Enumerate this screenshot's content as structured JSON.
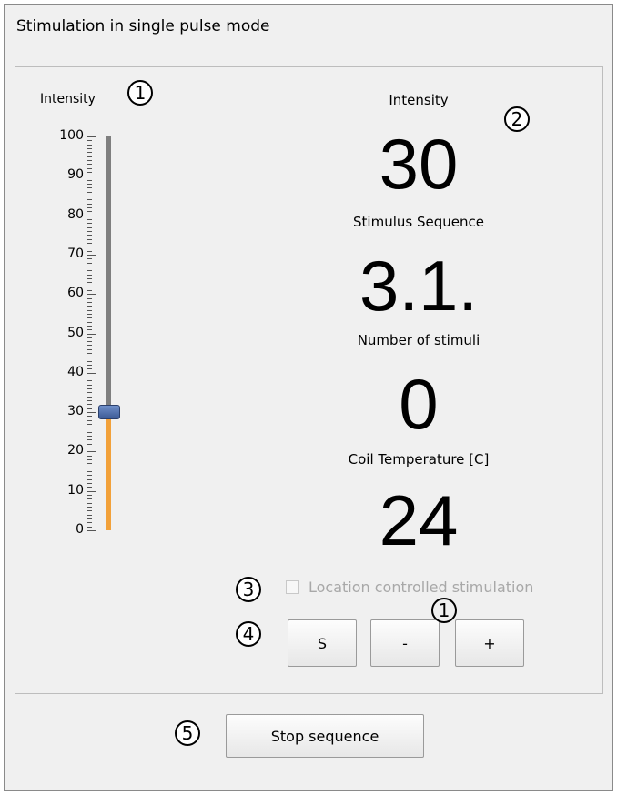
{
  "window": {
    "title": "Stimulation in single pulse mode"
  },
  "slider": {
    "label": "Intensity",
    "scale_labels": [
      "100",
      "90",
      "80",
      "70",
      "60",
      "50",
      "40",
      "30",
      "20",
      "10",
      "0"
    ],
    "value": 30,
    "min": 0,
    "max": 100,
    "filled_color": "#f2a13a",
    "track_color": "#7f7f7f"
  },
  "readouts": [
    {
      "label": "Intensity",
      "value": "30"
    },
    {
      "label": "Stimulus Sequence",
      "value": "3.1."
    },
    {
      "label": "Number of stimuli",
      "value": "0"
    },
    {
      "label": "Coil Temperature [C]",
      "value": "24"
    }
  ],
  "location_control": {
    "label": "Location controlled stimulation",
    "checked": false,
    "enabled": false
  },
  "buttons": {
    "s": "S",
    "minus": "-",
    "plus": "+",
    "stop": "Stop sequence"
  },
  "callouts": {
    "slider": "1",
    "readouts": "2",
    "checkbox": "3",
    "buttons": "4",
    "stop": "5",
    "buttons_overlay": "1"
  }
}
